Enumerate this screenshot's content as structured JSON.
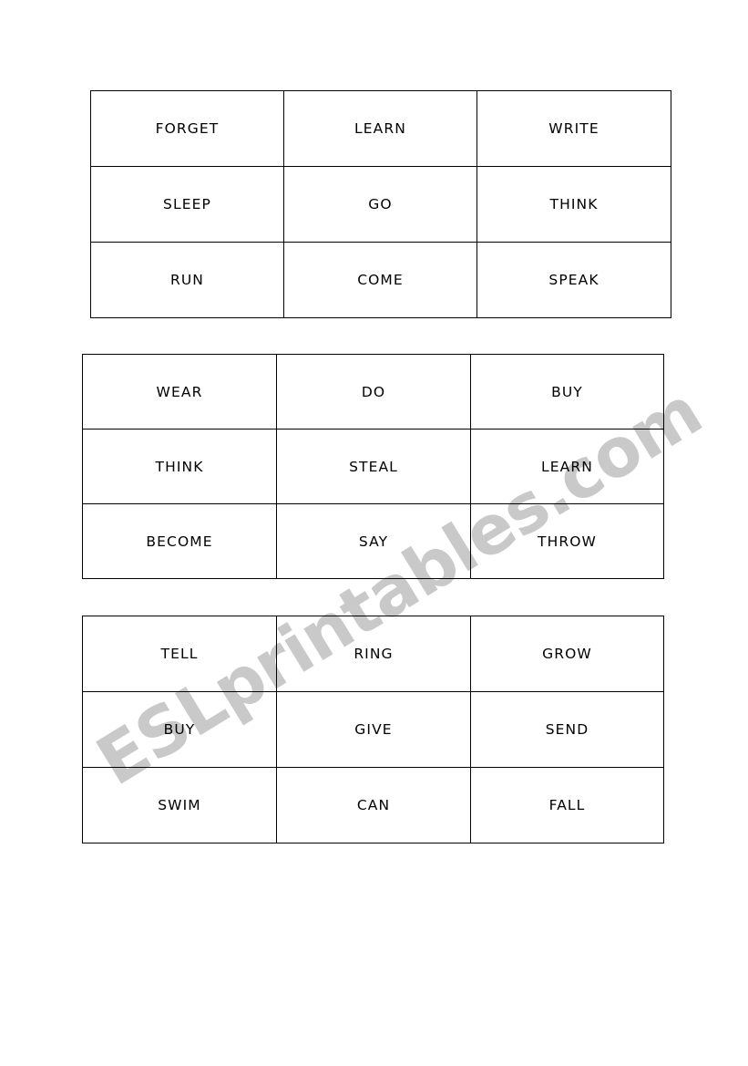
{
  "page": {
    "background_color": "#ffffff",
    "border_color": "#000000",
    "text_color": "#000000"
  },
  "watermark": {
    "text": "ESLprintables.com",
    "color": "#c9c9c9"
  },
  "tables": [
    {
      "name": "verb-card-grid-1",
      "rows": [
        [
          "FORGET",
          "LEARN",
          "WRITE"
        ],
        [
          "SLEEP",
          "GO",
          "THINK"
        ],
        [
          "RUN",
          "COME",
          "SPEAK"
        ]
      ]
    },
    {
      "name": "verb-card-grid-2",
      "rows": [
        [
          "WEAR",
          "DO",
          "BUY"
        ],
        [
          "THINK",
          "STEAL",
          "LEARN"
        ],
        [
          "BECOME",
          "SAY",
          "THROW"
        ]
      ]
    },
    {
      "name": "verb-card-grid-3",
      "rows": [
        [
          "TELL",
          "RING",
          "GROW"
        ],
        [
          "BUY",
          "GIVE",
          "SEND"
        ],
        [
          "SWIM",
          "CAN",
          "FALL"
        ]
      ]
    }
  ]
}
